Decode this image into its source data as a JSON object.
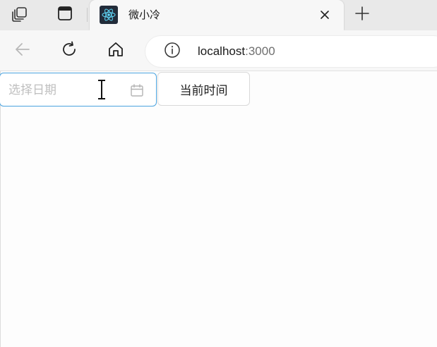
{
  "browser": {
    "tab": {
      "title": "微小冷",
      "favicon": "react-logo-icon"
    },
    "address": {
      "host": "localhost",
      "port": ":3000"
    },
    "icons": {
      "workspaces": "workspaces-icon",
      "vertical_tabs": "vertical-tabs-icon",
      "close": "close-icon",
      "new_tab": "plus-icon",
      "back": "back-arrow-icon",
      "reload": "reload-icon",
      "home": "home-icon",
      "site_info": "info-icon"
    }
  },
  "page": {
    "date_picker": {
      "placeholder": "选择日期",
      "value": "",
      "icon": "calendar-icon"
    },
    "now_button": {
      "label": "当前时间"
    }
  },
  "colors": {
    "accent_focus_border": "#4aa3df",
    "placeholder_text": "#bfbfbf",
    "react_logo": "#61dafb"
  }
}
